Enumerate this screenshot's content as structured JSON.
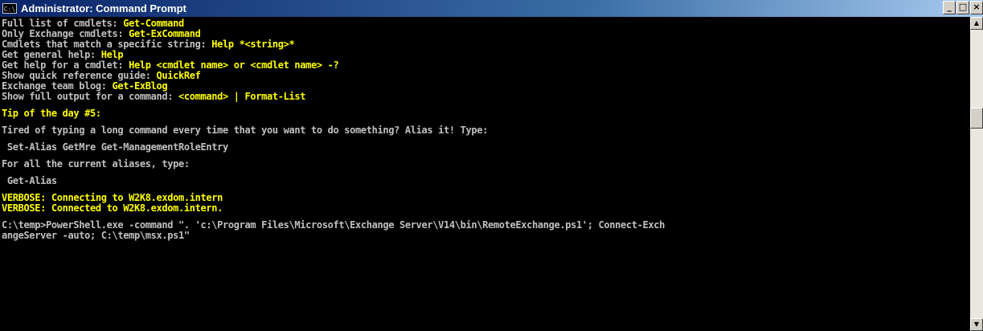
{
  "window": {
    "title": "Administrator: Command Prompt",
    "icon_label": "C:\\",
    "controls": {
      "minimize": "_",
      "maximize": "□",
      "close": "×"
    }
  },
  "console": {
    "lines": [
      {
        "parts": [
          {
            "text": "Full list of cmdlets: ",
            "color": "gray"
          },
          {
            "text": "Get-Command",
            "color": "yellow"
          }
        ]
      },
      {
        "parts": [
          {
            "text": "Only Exchange cmdlets: ",
            "color": "gray"
          },
          {
            "text": "Get-ExCommand",
            "color": "yellow"
          }
        ]
      },
      {
        "parts": [
          {
            "text": "Cmdlets that match a specific string: ",
            "color": "gray"
          },
          {
            "text": "Help *<string>*",
            "color": "yellow"
          }
        ]
      },
      {
        "parts": [
          {
            "text": "Get general help: ",
            "color": "gray"
          },
          {
            "text": "Help",
            "color": "yellow"
          }
        ]
      },
      {
        "parts": [
          {
            "text": "Get help for a cmdlet: ",
            "color": "gray"
          },
          {
            "text": "Help <cmdlet name> or <cmdlet name> -?",
            "color": "yellow"
          }
        ]
      },
      {
        "parts": [
          {
            "text": "Show quick reference guide: ",
            "color": "gray"
          },
          {
            "text": "QuickRef",
            "color": "yellow"
          }
        ]
      },
      {
        "parts": [
          {
            "text": "Exchange team blog: ",
            "color": "gray"
          },
          {
            "text": "Get-ExBlog",
            "color": "yellow"
          }
        ]
      },
      {
        "parts": [
          {
            "text": "Show full output for a command: ",
            "color": "gray"
          },
          {
            "text": "<command> | Format-List",
            "color": "yellow"
          }
        ]
      },
      {
        "parts": []
      },
      {
        "parts": [
          {
            "text": "Tip of the day #5:",
            "color": "yellow"
          }
        ]
      },
      {
        "parts": []
      },
      {
        "parts": [
          {
            "text": "Tired of typing a long command every time that you want to do something? Alias it! Type:",
            "color": "gray"
          }
        ]
      },
      {
        "parts": []
      },
      {
        "parts": [
          {
            "text": " Set-Alias GetMre Get-ManagementRoleEntry",
            "color": "gray"
          }
        ]
      },
      {
        "parts": []
      },
      {
        "parts": [
          {
            "text": "For all the current aliases, type:",
            "color": "gray"
          }
        ]
      },
      {
        "parts": []
      },
      {
        "parts": [
          {
            "text": " Get-Alias",
            "color": "gray"
          }
        ]
      },
      {
        "parts": []
      },
      {
        "parts": [
          {
            "text": "VERBOSE: Connecting to W2K8.exdom.intern",
            "color": "yellow"
          }
        ]
      },
      {
        "parts": [
          {
            "text": "VERBOSE: Connected to W2K8.exdom.intern.",
            "color": "yellow"
          }
        ]
      },
      {
        "parts": []
      },
      {
        "parts": [
          {
            "text": "C:\\temp>PowerShell.exe -command \". 'c:\\Program Files\\Microsoft\\Exchange Server\\V14\\bin\\RemoteExchange.ps1'; Connect-Exch",
            "color": "gray"
          }
        ]
      },
      {
        "parts": [
          {
            "text": "angeServer -auto; C:\\temp\\msx.ps1\"",
            "color": "gray"
          }
        ]
      }
    ]
  },
  "scrollbar": {
    "up_arrow": "▲",
    "down_arrow": "▼"
  },
  "colors": {
    "gray": "#c0c0c0",
    "yellow": "#ffff00",
    "background": "#000000"
  }
}
